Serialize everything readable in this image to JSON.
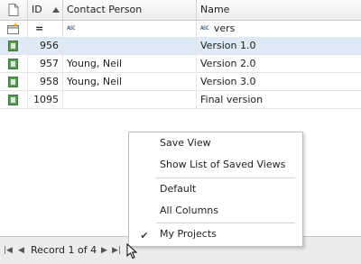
{
  "header": {
    "id_label": "ID",
    "contact_label": "Contact Person",
    "name_label": "Name"
  },
  "filter": {
    "id_operator": "=",
    "name_value": "vers"
  },
  "rows": [
    {
      "id": "956",
      "contact": "",
      "name": "Version 1.0",
      "selected": true
    },
    {
      "id": "957",
      "contact": "Young, Neil",
      "name": "Version 2.0"
    },
    {
      "id": "958",
      "contact": "Young, Neil",
      "name": "Version 3.0"
    },
    {
      "id": "1095",
      "contact": "",
      "name": "Final version"
    }
  ],
  "navigator": {
    "record_text": "Record 1 of 4"
  },
  "context_menu": {
    "items": [
      {
        "label": "Save View"
      },
      {
        "label": "Show List of Saved Views"
      },
      {
        "label": "Default"
      },
      {
        "label": "All Columns"
      },
      {
        "label": "My Projects",
        "checked": true
      }
    ]
  },
  "colors": {
    "selected_row": "#deebf7",
    "record_icon": "#5e9a5a"
  }
}
